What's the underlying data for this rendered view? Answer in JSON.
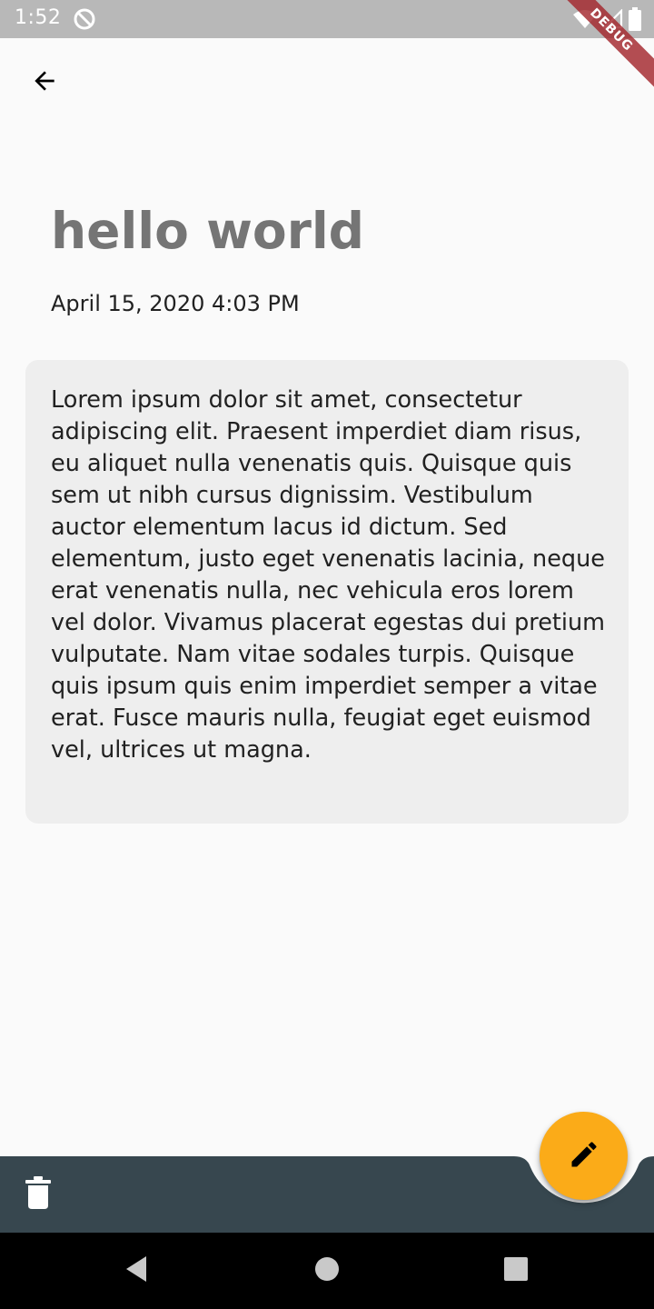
{
  "status_bar": {
    "time": "1:52",
    "icons": [
      "do-not-disturb-icon",
      "wifi-icon",
      "cell-signal-icon",
      "battery-icon"
    ]
  },
  "debug_banner": "DEBUG",
  "app_bar": {
    "back_icon": "arrow-back-icon"
  },
  "note": {
    "title": "hello world",
    "date": "April 15, 2020 4:03 PM",
    "body": "Lorem ipsum dolor sit amet, consectetur adipiscing elit. Praesent imperdiet diam risus, eu aliquet nulla venenatis quis. Quisque quis sem ut nibh cursus dignissim. Vestibulum auctor elementum lacus id dictum. Sed elementum, justo eget venenatis lacinia, neque erat venenatis nulla, nec vehicula eros lorem vel dolor. Vivamus placerat egestas dui pretium vulputate. Nam vitae sodales turpis. Quisque quis ipsum quis enim imperdiet semper a vitae erat. Fusce mauris nulla, feugiat eget euismod vel, ultrices ut magna."
  },
  "bottom_bar": {
    "delete_icon": "trash-icon",
    "fab_icon": "pencil-icon"
  },
  "nav_bar": {
    "icons": [
      "nav-back-icon",
      "nav-home-icon",
      "nav-recents-icon"
    ]
  },
  "colors": {
    "status_bar": "#b8b8b8",
    "background": "#fafafa",
    "title": "#757575",
    "card": "#eeeeee",
    "bottom_bar": "#37474f",
    "fab": "#fbab18",
    "debug_banner": "#a3272d"
  }
}
